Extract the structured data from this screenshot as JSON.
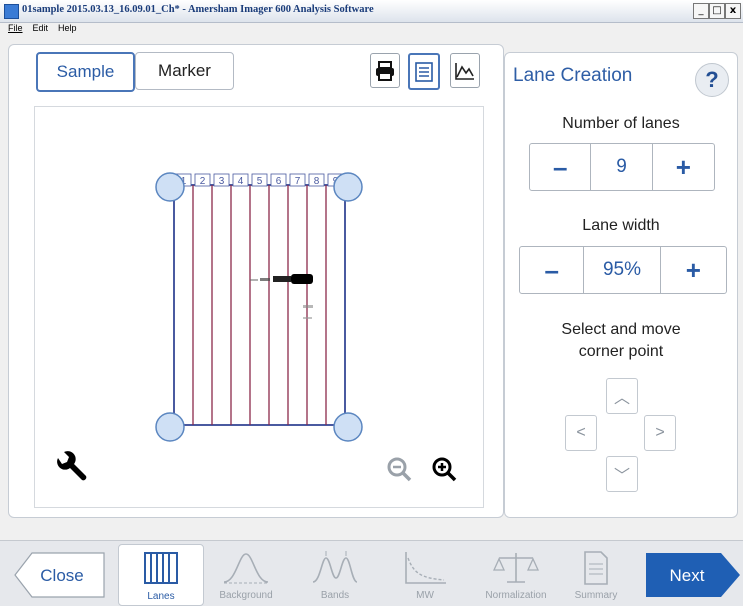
{
  "window": {
    "title": "01sample 2015.03.13_16.09.01_Ch* - Amersham Imager 600 Analysis Software",
    "min_label": "_",
    "max_label": "□",
    "close_label": "x"
  },
  "menu": [
    "File",
    "Edit",
    "Help"
  ],
  "tabs": {
    "sample": "Sample",
    "marker": "Marker"
  },
  "toolbar": {
    "icons": [
      "printer-icon",
      "list-icon",
      "chart-icon"
    ]
  },
  "gel": {
    "lane_numbers": [
      "1",
      "2",
      "3",
      "4",
      "5",
      "6",
      "7",
      "8",
      "9"
    ]
  },
  "lane_creation": {
    "title": "Lane Creation",
    "help_label": "?",
    "number_of_lanes_label": "Number of lanes",
    "number_of_lanes_value": "9",
    "lane_width_label": "Lane width",
    "lane_width_value": "95%",
    "minus": "–",
    "plus": "+",
    "corner_label_1": "Select and move",
    "corner_label_2": "corner point"
  },
  "bottom_nav": {
    "close": "Close",
    "next": "Next",
    "items": [
      {
        "label": "Lanes",
        "active": true
      },
      {
        "label": "Background",
        "active": false
      },
      {
        "label": "Bands",
        "active": false
      },
      {
        "label": "MW",
        "active": false
      },
      {
        "label": "Normalization",
        "active": false
      },
      {
        "label": "Summary",
        "active": false
      }
    ]
  },
  "colors": {
    "accent": "#2a5ba5",
    "next_bg": "#1f5fb4",
    "lane_line": "#8b2a4a",
    "frame": "#4a5aa0"
  }
}
